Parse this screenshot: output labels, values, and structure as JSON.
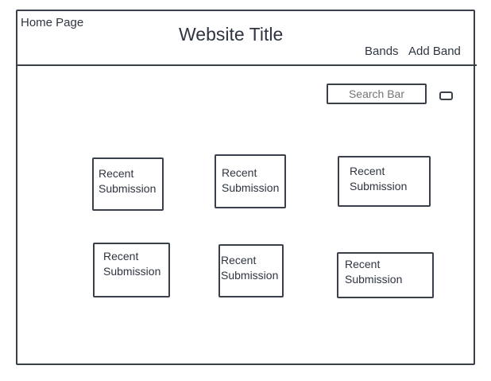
{
  "header": {
    "home_link": "Home Page",
    "site_title": "Website Title",
    "nav": {
      "bands": "Bands",
      "add_band": "Add Band"
    }
  },
  "search": {
    "placeholder": "Search Bar",
    "button_icon": "search-button-icon"
  },
  "recent_submissions": [
    {
      "line1": "Recent",
      "line2": "Submission"
    },
    {
      "line1": "Recent",
      "line2": "Submission"
    },
    {
      "line1": "Recent",
      "line2": "Submission"
    },
    {
      "line1": "Recent",
      "line2": "Submission"
    },
    {
      "line1": "Recent",
      "line2": "Submission"
    },
    {
      "line1": "Recent",
      "line2": "Submission"
    }
  ],
  "colors": {
    "line": "#3a404a",
    "text": "#2f3540",
    "background": "#ffffff"
  }
}
